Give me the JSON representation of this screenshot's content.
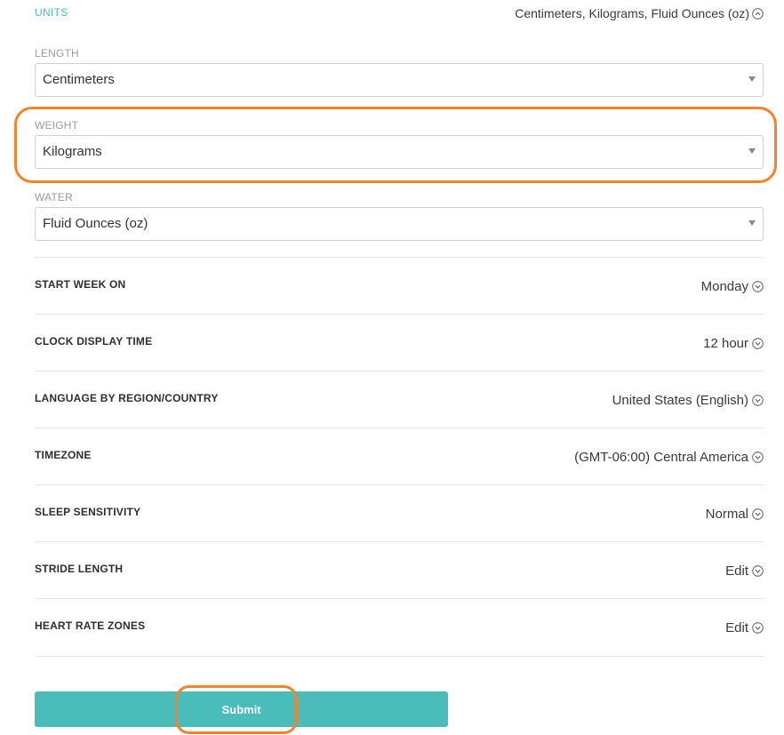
{
  "units": {
    "title": "UNITS",
    "summary": "Centimeters, Kilograms, Fluid Ounces (oz)",
    "icon": "chevron-up-circle-icon",
    "fields": [
      {
        "label": "LENGTH",
        "value": "Centimeters"
      },
      {
        "label": "WEIGHT",
        "value": "Kilograms"
      },
      {
        "label": "WATER",
        "value": "Fluid Ounces (oz)"
      }
    ]
  },
  "settings": [
    {
      "label": "START WEEK ON",
      "value": "Monday"
    },
    {
      "label": "CLOCK DISPLAY TIME",
      "value": "12 hour"
    },
    {
      "label": "LANGUAGE BY REGION/COUNTRY",
      "value": "United States (English)"
    },
    {
      "label": "TIMEZONE",
      "value": "(GMT-06:00) Central America"
    },
    {
      "label": "SLEEP SENSITIVITY",
      "value": "Normal"
    },
    {
      "label": "STRIDE LENGTH",
      "value": "Edit"
    },
    {
      "label": "HEART RATE ZONES",
      "value": "Edit"
    }
  ],
  "submit_label": "Submit",
  "colors": {
    "accent": "#4ABDBA",
    "highlight": "#F5832A"
  }
}
